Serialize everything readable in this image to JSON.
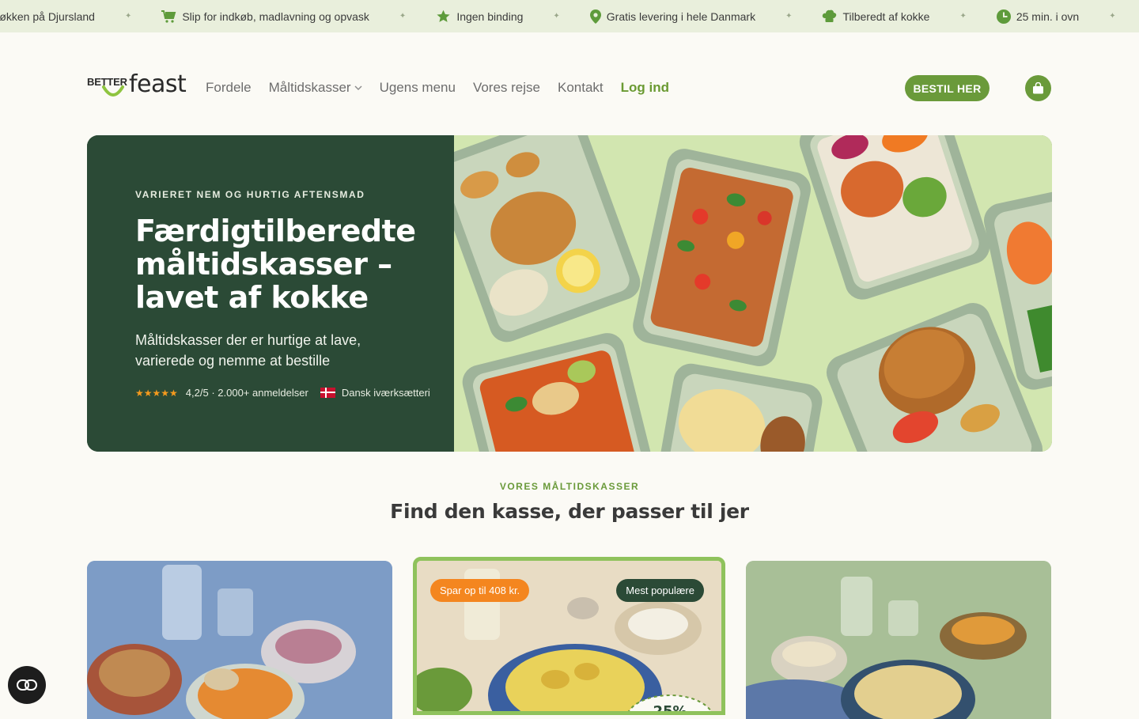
{
  "announcement": {
    "items": [
      {
        "icon": "none",
        "text": "Køkken på Djursland"
      },
      {
        "icon": "cart-icon",
        "text": "Slip for indkøb, madlavning og opvask"
      },
      {
        "icon": "star-icon",
        "text": "Ingen binding"
      },
      {
        "icon": "location-pin-icon",
        "text": "Gratis levering i hele Danmark"
      },
      {
        "icon": "chef-hat-icon",
        "text": "Tilberedt af kokke"
      },
      {
        "icon": "clock-icon",
        "text": "25 min. i ovn"
      }
    ],
    "separator": "✦"
  },
  "header": {
    "logo_better": "BETTER",
    "logo_feast": "feast",
    "nav": [
      {
        "label": "Fordele"
      },
      {
        "label": "Måltidskasser",
        "has_dropdown": true
      },
      {
        "label": "Ugens menu"
      },
      {
        "label": "Vores rejse"
      },
      {
        "label": "Kontakt"
      },
      {
        "label": "Log ind"
      }
    ],
    "cta_label": "BESTIL HER"
  },
  "hero": {
    "eyebrow": "VARIERET NEM OG HURTIG AFTENSMAD",
    "title": "Færdigtilberedte måltidskasser – lavet af kokke",
    "subtitle": "Måltidskasser der er hurtige at lave, varierede og nemme at bestille",
    "stars": "★★★★★",
    "rating_text": "4,2/5 · 2.000+ anmeldelser",
    "badge_text": "Dansk iværksætteri"
  },
  "section": {
    "eyebrow": "VORES MÅLTIDSKASSER",
    "title": "Find den kasse, der passer til jer"
  },
  "cards": [
    {
      "badges": []
    },
    {
      "badges": [
        "Spar op til 408 kr.",
        "Mest populære"
      ]
    },
    {
      "badges": []
    }
  ],
  "colors": {
    "brand_green": "#6a9a3a",
    "hero_dark": "#2b4a36",
    "accent_orange": "#f4861f",
    "topbar": "#e9efdc"
  }
}
